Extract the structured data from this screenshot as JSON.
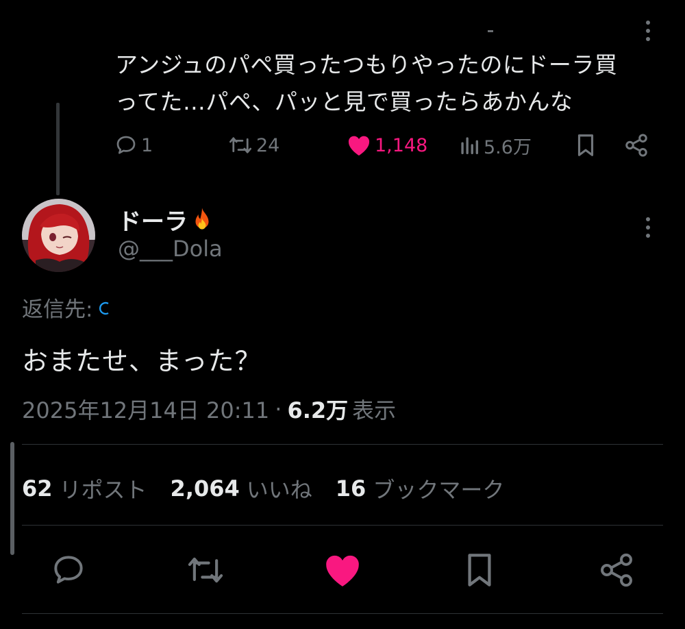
{
  "parent": {
    "text_line1": "アンジュのパペ買ったつもりやったのにドーラ買",
    "text_line2": "ってた…パペ、パッと見で買ったらあかんな",
    "reply_count": "1",
    "repost_count": "24",
    "like_count": "1,148",
    "view_count": "5.6万"
  },
  "main": {
    "display_name": "ドーラ",
    "handle": "@___Dola",
    "reply_to_label": "返信先:",
    "text": "おまたせ、まった？",
    "timestamp": "2025年12月14日 20:11",
    "views_value": "6.2万",
    "views_label": "表示",
    "stats": [
      {
        "value": "62",
        "label": "リポスト"
      },
      {
        "value": "2,064",
        "label": "いいね"
      },
      {
        "value": "16",
        "label": "ブックマーク"
      }
    ]
  },
  "colors": {
    "background": "#000000",
    "text_primary": "#e7e9ea",
    "text_secondary": "#71767b",
    "like_pink": "#f91880",
    "link_blue": "#1d9bf0",
    "divider": "#2f3336"
  },
  "icons": {
    "reply": "speech-bubble-icon",
    "repost": "repost-arrows-icon",
    "like": "heart-icon",
    "views": "bar-chart-icon",
    "bookmark": "bookmark-icon",
    "share": "share-nodes-icon",
    "more": "vertical-dots-icon",
    "fire": "fire-emoji-icon"
  }
}
